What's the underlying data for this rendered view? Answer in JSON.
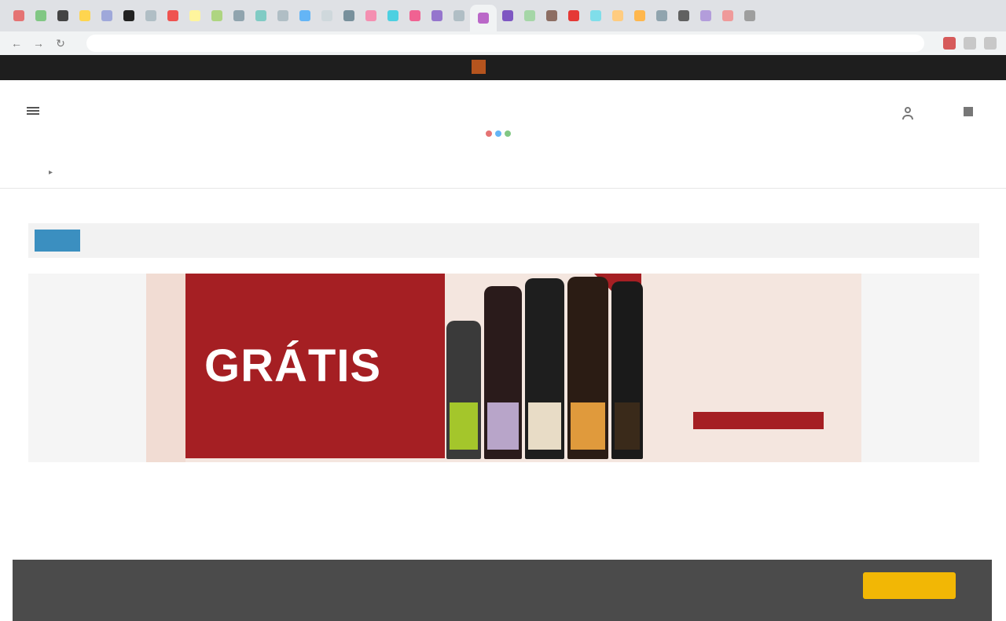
{
  "browser": {
    "tabs": [
      {
        "color": "#e57373"
      },
      {
        "color": "#81c784"
      },
      {
        "color": "#444444"
      },
      {
        "color": "#ffd54f"
      },
      {
        "color": "#9fa8da"
      },
      {
        "color": "#222222"
      },
      {
        "color": "#b0bec5"
      },
      {
        "color": "#ef5350"
      },
      {
        "color": "#fff59d"
      },
      {
        "color": "#aed581"
      },
      {
        "color": "#90a4ae"
      },
      {
        "color": "#80cbc4"
      },
      {
        "color": "#b0bec5"
      },
      {
        "color": "#64b5f6"
      },
      {
        "color": "#cfd8dc"
      },
      {
        "color": "#78909c"
      },
      {
        "color": "#f48fb1"
      },
      {
        "color": "#4dd0e1"
      },
      {
        "color": "#f06292"
      },
      {
        "color": "#9575cd"
      },
      {
        "color": "#b0bec5"
      },
      {
        "color": "#ba68c8"
      },
      {
        "color": "#7e57c2"
      },
      {
        "color": "#a5d6a7"
      },
      {
        "color": "#8d6e63"
      },
      {
        "color": "#e53935"
      },
      {
        "color": "#80deea"
      },
      {
        "color": "#ffcc80"
      },
      {
        "color": "#ffb74d"
      },
      {
        "color": "#90a4ae"
      },
      {
        "color": "#616161"
      },
      {
        "color": "#b39ddb"
      },
      {
        "color": "#ef9a9a"
      },
      {
        "color": "#9e9e9e"
      }
    ],
    "active_tab_color": "#e0e0e0"
  },
  "topbar": {
    "links": [
      "",
      "",
      "",
      ""
    ],
    "logo_text": "",
    "right_links": [
      "",
      ""
    ]
  },
  "header": {
    "menu_label": "",
    "live_label": "",
    "masthead": "",
    "account_label": "",
    "subscribe_label": ""
  },
  "secnav": {
    "items": [
      "",
      "",
      "",
      "",
      "",
      "",
      ""
    ]
  },
  "alert": {
    "badge": "",
    "text": ""
  },
  "ad": {
    "headline": "GRÁTIS",
    "price": "",
    "cta": "",
    "kicker": "",
    "sub": "",
    "offer": "",
    "side_text": "",
    "marker": "",
    "bottles": [
      {
        "color": "#3a3a3a",
        "label": "#a4c62b"
      },
      {
        "color": "#2a1b1b",
        "label": "#b8a5c9"
      },
      {
        "color": "#1e1e1e",
        "label": "#e8dcc6"
      },
      {
        "color": "#2b1c14",
        "label": "#e09a3c"
      },
      {
        "color": "#1a1a1a",
        "label": "#3a2a1a"
      }
    ]
  },
  "article": {
    "kicker": "",
    "title": ""
  },
  "cookie": {
    "text": "",
    "button": "",
    "link": ""
  }
}
